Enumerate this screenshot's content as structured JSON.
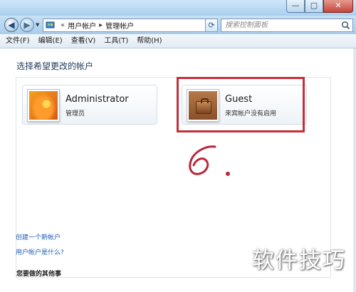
{
  "window": {
    "controls": {
      "minimize": "—",
      "maximize": "▢",
      "close": "✕"
    }
  },
  "nav": {
    "back_icon": "◀",
    "forward_icon": "▶",
    "dropdown_icon": "▼",
    "refresh_icon": "⟳"
  },
  "address": {
    "prefix": "«",
    "crumb1": "用户帐户",
    "sep": "▸",
    "crumb2": "管理帐户",
    "dropdown": "▼"
  },
  "search": {
    "placeholder": "搜索控制面板"
  },
  "menu": {
    "items": [
      "文件(F)",
      "编辑(E)",
      "查看(V)",
      "工具(T)",
      "帮助(H)"
    ]
  },
  "main": {
    "title": "选择希望更改的帐户",
    "accounts": [
      {
        "name": "Administrator",
        "subtitle": "管理员",
        "icon": "user-avatar-orange-flower"
      },
      {
        "name": "Guest",
        "subtitle": "来宾帐户没有启用",
        "icon": "user-avatar-suitcase"
      }
    ],
    "links": [
      "创建一个新帐户",
      "用户帐户是什么?"
    ],
    "more_title": "您要做的其他事"
  },
  "annotation": {
    "color": "#c42f3a"
  },
  "watermark": "软件技巧",
  "colors": {
    "link": "#1f5fb2",
    "title": "#1e395b",
    "highlight": "#c42f3a"
  }
}
